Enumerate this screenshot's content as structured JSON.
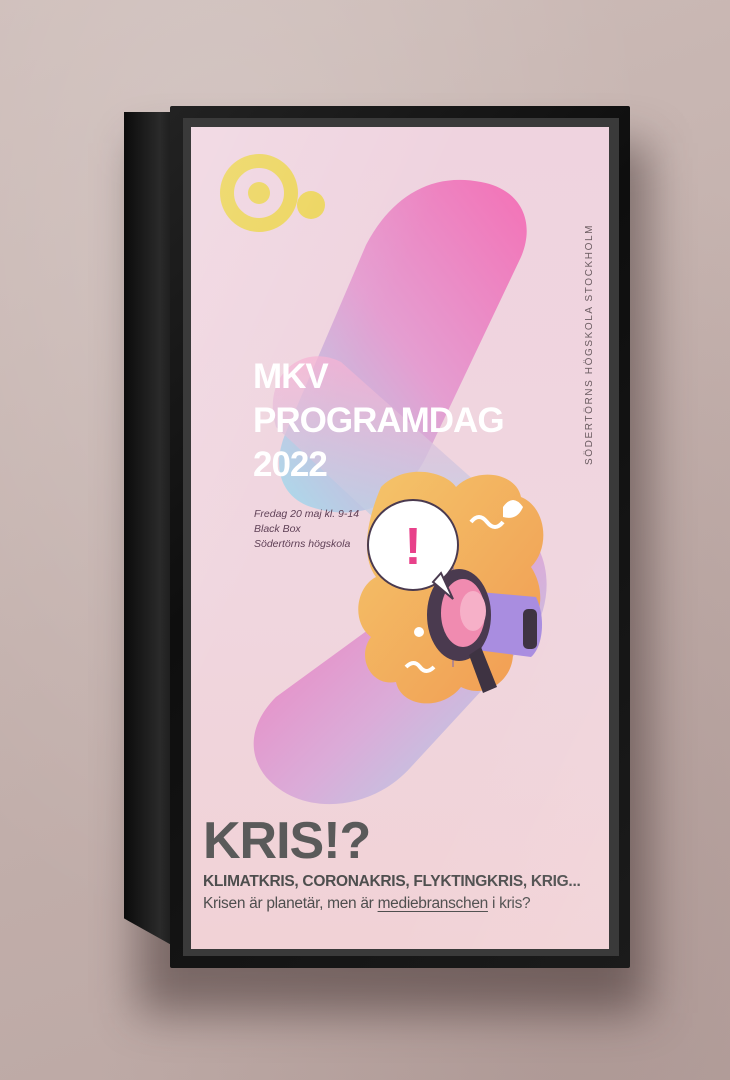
{
  "poster": {
    "vertical_text": "SÖDERTÖRNS HÖGSKOLA STOCKHOLM",
    "title_lines": [
      "MKV",
      "PROGRAMDAG",
      "2022"
    ],
    "details": [
      "Fredag 20 maj kl. 9-14",
      "Black Box",
      "Södertörns högskola"
    ],
    "headline": "KRIS!?",
    "subline1": "KLIMATKRIS, CORONAKRIS, FLYKTINGKRIS, KRIG...",
    "subline2_prefix": "Krisen är planetär, men är ",
    "subline2_underlined": "mediebranschen",
    "subline2_suffix": " i kris?",
    "illustration_mark": "!"
  },
  "colors": {
    "wall": "#c6b4b0",
    "frame": "#141414",
    "poster_bg": "#f0d4dd",
    "logo_yellow": "#ecd45a",
    "gradient_pink": "#f46cb4",
    "gradient_blue": "#a6dcec",
    "illustration_orange": "#f3b05a",
    "megaphone_purple": "#a98de0",
    "text_gray": "#555555"
  },
  "icons": [
    "logo-circles-icon",
    "megaphone-icon",
    "speech-bubble-icon"
  ]
}
